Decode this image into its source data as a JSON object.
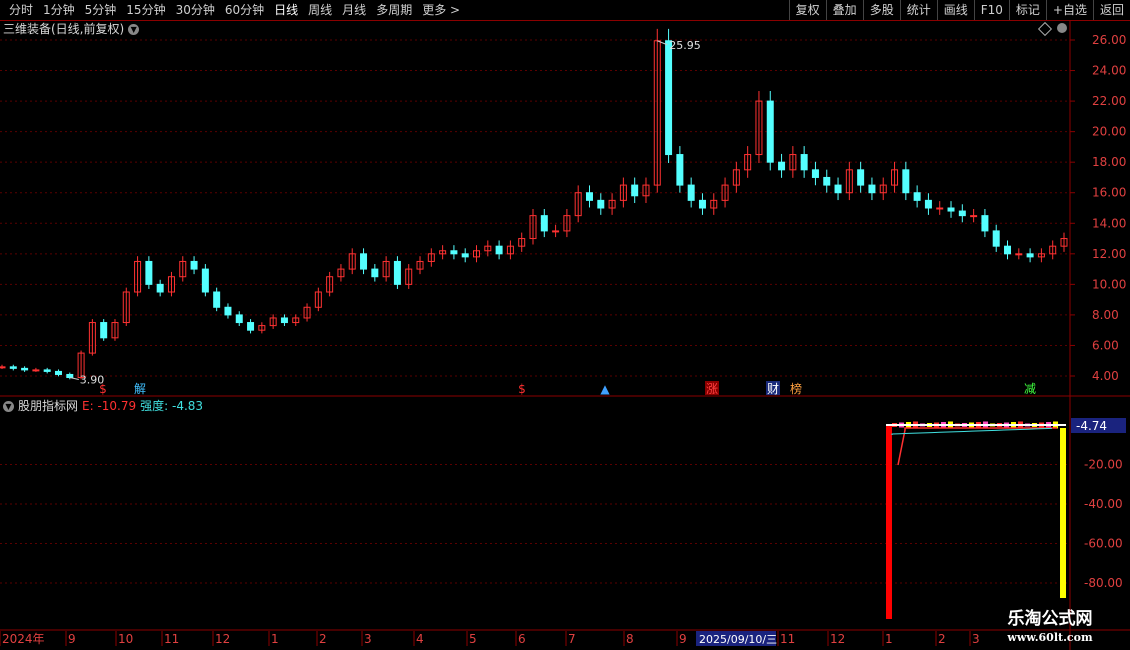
{
  "toolbar": {
    "periods": [
      "分时",
      "1分钟",
      "5分钟",
      "15分钟",
      "30分钟",
      "60分钟",
      "日线",
      "周线",
      "月线",
      "多周期",
      "更多 >"
    ],
    "active_period": "日线",
    "tools": [
      "复权",
      "叠加",
      "多股",
      "统计",
      "画线",
      "F10",
      "标记",
      "+自选",
      "返回"
    ]
  },
  "main_chart": {
    "title": "三维装备(日线,前复权)",
    "price_axis": [
      "26.00",
      "24.00",
      "22.00",
      "20.00",
      "18.00",
      "16.00",
      "14.00",
      "12.00",
      "10.00",
      "8.00",
      "6.00",
      "4.00"
    ],
    "high_label": "25.95",
    "low_label": "3.90",
    "markers": [
      {
        "text": "$",
        "color": "#ff3030"
      },
      {
        "text": "解",
        "color": "#40c0ff"
      },
      {
        "text": "$",
        "color": "#ff3030"
      },
      {
        "text": "▲",
        "color": "#40a0ff"
      },
      {
        "text": "涨",
        "color": "#ff4040"
      },
      {
        "text": "财",
        "color": "#ffffff"
      },
      {
        "text": "榜",
        "color": "#ffa040"
      },
      {
        "text": "减",
        "color": "#40ff40"
      }
    ]
  },
  "indicator": {
    "name": "股朋指标网",
    "e_label": "E: -10.79",
    "strength_label": "强度: -4.83",
    "axis": [
      "-20.00",
      "-40.00",
      "-60.00",
      "-80.00"
    ],
    "current_value": "-4.74",
    "colors": {
      "e": "#ff3030",
      "strength": "#40e0e0",
      "bar_red": "#ff0000",
      "bar_yellow": "#ffff00"
    }
  },
  "time_axis": {
    "labels": [
      "2024年",
      "9",
      "10",
      "11",
      "12",
      "1",
      "2",
      "3",
      "4",
      "5",
      "6",
      "7",
      "8",
      "9",
      "11",
      "12",
      "1",
      "2",
      "3"
    ],
    "cursor_date": "2025/09/10/三"
  },
  "watermark": {
    "line1": "乐淘公式网",
    "line2": "www.60lt.com"
  },
  "chart_data": {
    "type": "candlestick",
    "title": "三维装备(日线,前复权)",
    "ylim": [
      3,
      27
    ],
    "close_series": [
      4.6,
      4.5,
      4.4,
      4.4,
      4.3,
      4.1,
      3.9,
      5.5,
      7.5,
      6.5,
      7.5,
      9.5,
      11.5,
      10.0,
      9.5,
      10.5,
      11.5,
      11.0,
      9.5,
      8.5,
      8.0,
      7.5,
      7.0,
      7.3,
      7.8,
      7.5,
      7.8,
      8.5,
      9.5,
      10.5,
      11.0,
      12.0,
      11.0,
      10.5,
      11.5,
      10.0,
      11.0,
      11.5,
      12.0,
      12.2,
      12.0,
      11.8,
      12.2,
      12.5,
      12.0,
      12.5,
      13.0,
      14.5,
      13.5,
      13.5,
      14.5,
      16.0,
      15.5,
      15.0,
      15.5,
      16.5,
      15.8,
      16.5,
      25.95,
      18.5,
      16.5,
      15.5,
      15.0,
      15.5,
      16.5,
      17.5,
      18.5,
      22.0,
      18.0,
      17.5,
      18.5,
      17.5,
      17.0,
      16.5,
      16.0,
      17.5,
      16.5,
      16.0,
      16.5,
      17.5,
      16.0,
      15.5,
      15.0,
      15.0,
      14.8,
      14.5,
      14.5,
      13.5,
      12.5,
      12.0,
      12.0,
      11.8,
      12.0,
      12.5,
      13.0
    ],
    "high_label": 25.95,
    "low_label": 3.9
  }
}
